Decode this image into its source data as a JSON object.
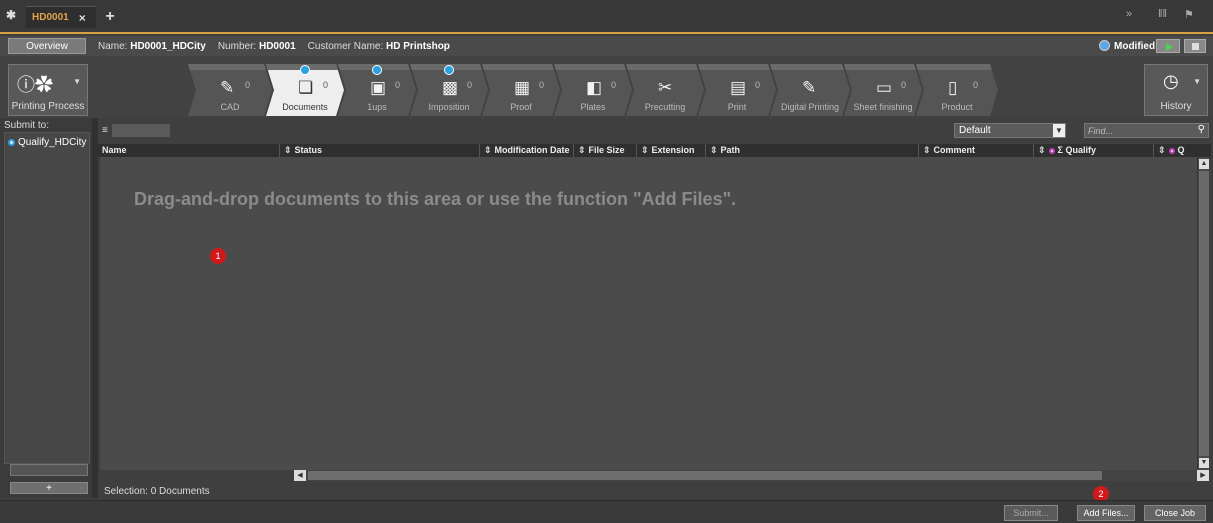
{
  "tabbar": {
    "job_tab_label": "HD0001",
    "close_glyph": "×",
    "add_glyph": "+",
    "right_icons": [
      "chevron-double-down-icon",
      "columns-icon",
      "flag-icon"
    ]
  },
  "infobar": {
    "overview_label": "Overview",
    "name_label": "Name:",
    "name_value": "HD0001_HDCity",
    "number_label": "Number:",
    "number_value": "HD0001",
    "customer_label": "Customer Name:",
    "customer_value": "HD Printshop",
    "status_label": "Modified",
    "status_color": "#5da7e8"
  },
  "ribbon": {
    "printing_process_label": "Printing Process",
    "history_label": "History",
    "steps": [
      {
        "label": "CAD",
        "count": "0",
        "icon": "cad-icon",
        "active": false,
        "flag": false
      },
      {
        "label": "Documents",
        "count": "0",
        "icon": "documents-icon",
        "active": true,
        "flag": true
      },
      {
        "label": "1ups",
        "count": "0",
        "icon": "pdf-icon",
        "active": false,
        "flag": true
      },
      {
        "label": "Imposition",
        "count": "0",
        "icon": "imposition-icon",
        "active": false,
        "flag": true
      },
      {
        "label": "Proof",
        "count": "0",
        "icon": "proof-icon",
        "active": false,
        "flag": false
      },
      {
        "label": "Plates",
        "count": "0",
        "icon": "plates-icon",
        "active": false,
        "flag": false
      },
      {
        "label": "Precutting",
        "count": "",
        "icon": "precutting-icon",
        "active": false,
        "flag": false
      },
      {
        "label": "Print",
        "count": "0",
        "icon": "print-icon",
        "active": false,
        "flag": false
      },
      {
        "label": "Digital Printing",
        "count": "",
        "icon": "digital-printing-icon",
        "active": false,
        "flag": false
      },
      {
        "label": "Sheet finishing",
        "count": "0",
        "icon": "sheet-finishing-icon",
        "active": false,
        "flag": false
      },
      {
        "label": "Product",
        "count": "0",
        "icon": "product-icon",
        "active": false,
        "flag": false
      }
    ]
  },
  "leftpanel": {
    "submit_to_label": "Submit to:",
    "targets": [
      "Qualify_HDCity"
    ],
    "plus_label": "+"
  },
  "filter": {
    "view_selected": "Default",
    "find_placeholder": "Find..."
  },
  "table": {
    "columns": [
      "Name",
      "Status",
      "Modification Date",
      "File Size",
      "Extension",
      "Path",
      "Comment",
      "Σ Qualify",
      "Q"
    ],
    "rows": [],
    "drop_hint": "Drag-and-drop documents to this area or use the function \"Add Files\".",
    "selection_text": "Selection:  0 Documents"
  },
  "markers": [
    "1",
    "2"
  ],
  "footer": {
    "submit_label": "Submit...",
    "add_files_label": "Add Files...",
    "close_job_label": "Close Job"
  }
}
